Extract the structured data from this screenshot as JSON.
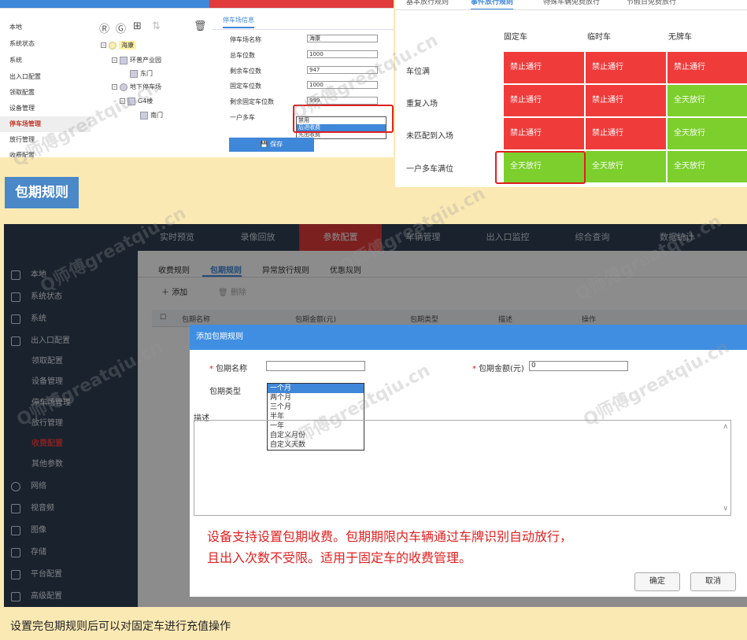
{
  "parking_ui": {
    "sidebar": [
      "本地",
      "系统状态",
      "系统",
      "出入口配置",
      "领取配置",
      "设备管理",
      "停车场管理",
      "放行管理",
      "收费配置"
    ],
    "tree": [
      "海康",
      "环普产业园",
      "东门",
      "地下停车场",
      "G4楼",
      "南门"
    ],
    "form_title": "停车场信息",
    "fields": [
      {
        "label": "停车场名称",
        "value": "海康"
      },
      {
        "label": "总车位数",
        "value": "1000"
      },
      {
        "label": "剩余车位数",
        "value": "947"
      },
      {
        "label": "固定车位数",
        "value": "1000"
      },
      {
        "label": "剩余固定车位数",
        "value": "999"
      }
    ],
    "multi_label": "一户多车",
    "multi_options": [
      "禁用",
      "后进收费",
      "先出收费"
    ],
    "save_label": "保存"
  },
  "rules_ui": {
    "tabs": [
      "基本放行规则",
      "事件放行规则",
      "特殊车辆免费放行",
      "节假日免费放行"
    ],
    "columns": [
      "固定车",
      "临时车",
      "无牌车"
    ],
    "rows": [
      {
        "label": "车位满",
        "cells": [
          {
            "text": "禁止通行",
            "color": "#f03b3b"
          },
          {
            "text": "禁止通行",
            "color": "#f03b3b"
          },
          {
            "text": "禁止通行",
            "color": "#f03b3b"
          }
        ]
      },
      {
        "label": "重复入场",
        "cells": [
          {
            "text": "禁止通行",
            "color": "#f03b3b"
          },
          {
            "text": "禁止通行",
            "color": "#f03b3b"
          },
          {
            "text": "全天放行",
            "color": "#7ccf2c"
          }
        ]
      },
      {
        "label": "未匹配到入场",
        "cells": [
          {
            "text": "禁止通行",
            "color": "#f03b3b"
          },
          {
            "text": "禁止通行",
            "color": "#f03b3b"
          },
          {
            "text": "全天放行",
            "color": "#7ccf2c"
          }
        ]
      },
      {
        "label": "一户多车满位",
        "cells": [
          {
            "text": "全天放行",
            "color": "#7ccf2c"
          },
          {
            "text": "全天放行",
            "color": "#7ccf2c"
          },
          {
            "text": "全天放行",
            "color": "#7ccf2c"
          }
        ]
      }
    ]
  },
  "section_title": "包期规则",
  "main": {
    "nav": [
      "实时预览",
      "录像回放",
      "参数配置",
      "车辆管理",
      "出入口监控",
      "综合查询",
      "数据统计"
    ],
    "sidebar": [
      {
        "label": "本地",
        "icon": "monitor-icon"
      },
      {
        "label": "系统状态",
        "icon": "status-icon"
      },
      {
        "label": "系统",
        "icon": "system-icon"
      },
      {
        "label": "出入口配置",
        "icon": "gate-icon"
      },
      {
        "label": "领取配置",
        "icon": ""
      },
      {
        "label": "设备管理",
        "icon": ""
      },
      {
        "label": "停车场管理",
        "icon": ""
      },
      {
        "label": "放行管理",
        "icon": ""
      },
      {
        "label": "收费配置",
        "icon": ""
      },
      {
        "label": "其他参数",
        "icon": ""
      },
      {
        "label": "网络",
        "icon": "globe-icon"
      },
      {
        "label": "视音频",
        "icon": "audio-icon"
      },
      {
        "label": "图像",
        "icon": "image-icon"
      },
      {
        "label": "存储",
        "icon": "storage-icon"
      },
      {
        "label": "平台配置",
        "icon": "platform-icon"
      },
      {
        "label": "高级配置",
        "icon": "wrench-icon"
      }
    ],
    "tabs": [
      "收费规则",
      "包期规则",
      "异常放行规则",
      "优惠规则"
    ],
    "toolbar": {
      "add": "添加",
      "delete": "删除"
    },
    "columns": [
      "包期名称",
      "包期金额(元)",
      "包期类型",
      "描述",
      "操作"
    ]
  },
  "dialog": {
    "title": "添加包期规则",
    "name_label": "包期名称",
    "amount_label": "包期金额(元)",
    "amount_value": "0",
    "type_label": "包期类型",
    "type_options": [
      "一个月",
      "两个月",
      "三个月",
      "半年",
      "一年",
      "自定义月份",
      "自定义天数"
    ],
    "desc_label": "描述",
    "note_line1": "设备支持设置包期收费。包期期限内车辆通过车牌识别自动放行，",
    "note_line2": "且出入次数不受限。适用于固定车的收费管理。",
    "ok": "确定",
    "cancel": "取消"
  },
  "caption": "设置完包期规则后可以对固定车进行充值操作",
  "watermark": "Q师傅greatqiu.cn"
}
